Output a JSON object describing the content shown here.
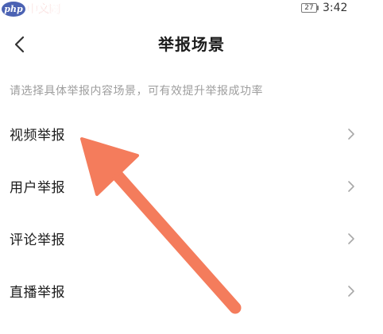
{
  "status_bar": {
    "watermark_logo": "php",
    "watermark_text": "中文网",
    "battery": "27",
    "time": "3:42"
  },
  "header": {
    "title": "举报场景"
  },
  "hint": "请选择具体举报内容场景，可有效提升举报成功率",
  "items": [
    {
      "label": "视频举报"
    },
    {
      "label": "用户举报"
    },
    {
      "label": "评论举报"
    },
    {
      "label": "直播举报"
    }
  ],
  "icons": {
    "back": "chevron-left-icon",
    "item": "chevron-right-icon"
  },
  "colors": {
    "annotation_arrow": "#f47c5c",
    "hint_text": "#9e9e9e",
    "chevron": "#a8a8a8"
  }
}
